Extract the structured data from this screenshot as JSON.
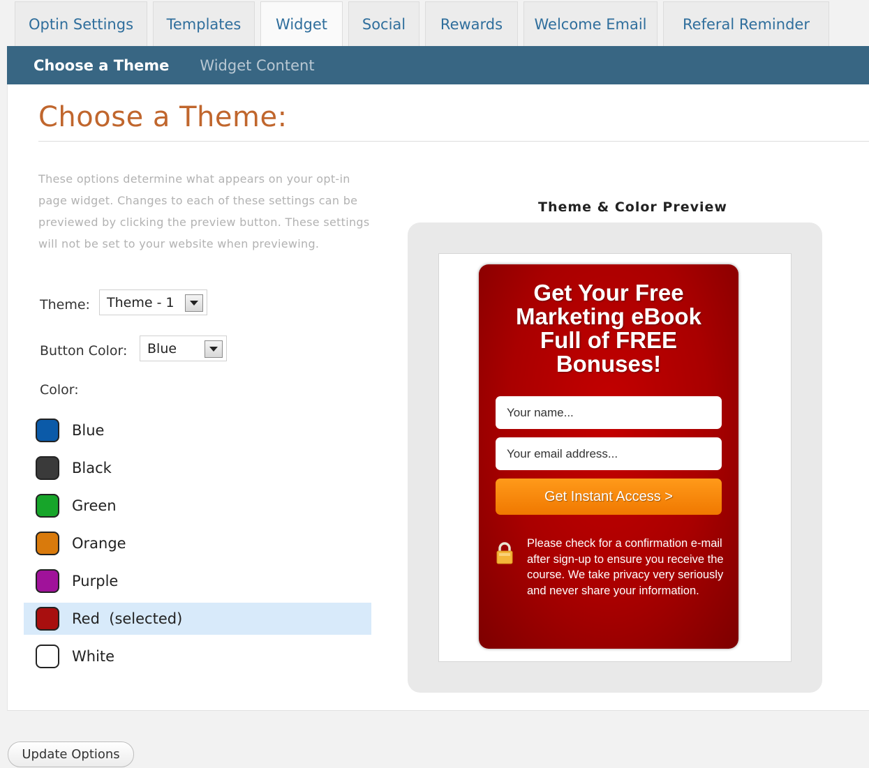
{
  "tabs": [
    {
      "label": "Optin Settings"
    },
    {
      "label": "Templates"
    },
    {
      "label": "Widget"
    },
    {
      "label": "Social"
    },
    {
      "label": "Rewards"
    },
    {
      "label": "Welcome Email"
    },
    {
      "label": "Referal Reminder"
    }
  ],
  "subnav": {
    "choose_theme": "Choose a Theme",
    "widget_content": "Widget Content"
  },
  "page": {
    "title": "Choose a Theme:",
    "description": "These options determine what appears on your opt-in page widget. Changes to each of these settings can be previewed by clicking the preview button. These settings will not be set to your website when previewing."
  },
  "form": {
    "theme_label": "Theme:",
    "theme_value": "Theme - 1",
    "button_color_label": "Button Color:",
    "button_color_value": "Blue",
    "color_label": "Color:"
  },
  "colors": [
    {
      "name": "Blue",
      "hex": "#0b5aa8"
    },
    {
      "name": "Black",
      "hex": "#3a3a3a"
    },
    {
      "name": "Green",
      "hex": "#17a52a"
    },
    {
      "name": "Orange",
      "hex": "#d97a0c"
    },
    {
      "name": "Purple",
      "hex": "#a0129a"
    },
    {
      "name": "Red  (selected)",
      "hex": "#a80f0f"
    },
    {
      "name": "White",
      "hex": "#ffffff"
    }
  ],
  "preview": {
    "title": "Theme & Color Preview",
    "headline": "Get Your Free Marketing eBook Full of FREE Bonuses!",
    "name_placeholder": "Your name...",
    "email_placeholder": "Your email address...",
    "button": "Get Instant Access >",
    "note": "Please check for a confirmation e-mail after sign-up to ensure you receive the course. We take privacy very seriously and never share your information."
  },
  "actions": {
    "update": "Update Options"
  }
}
